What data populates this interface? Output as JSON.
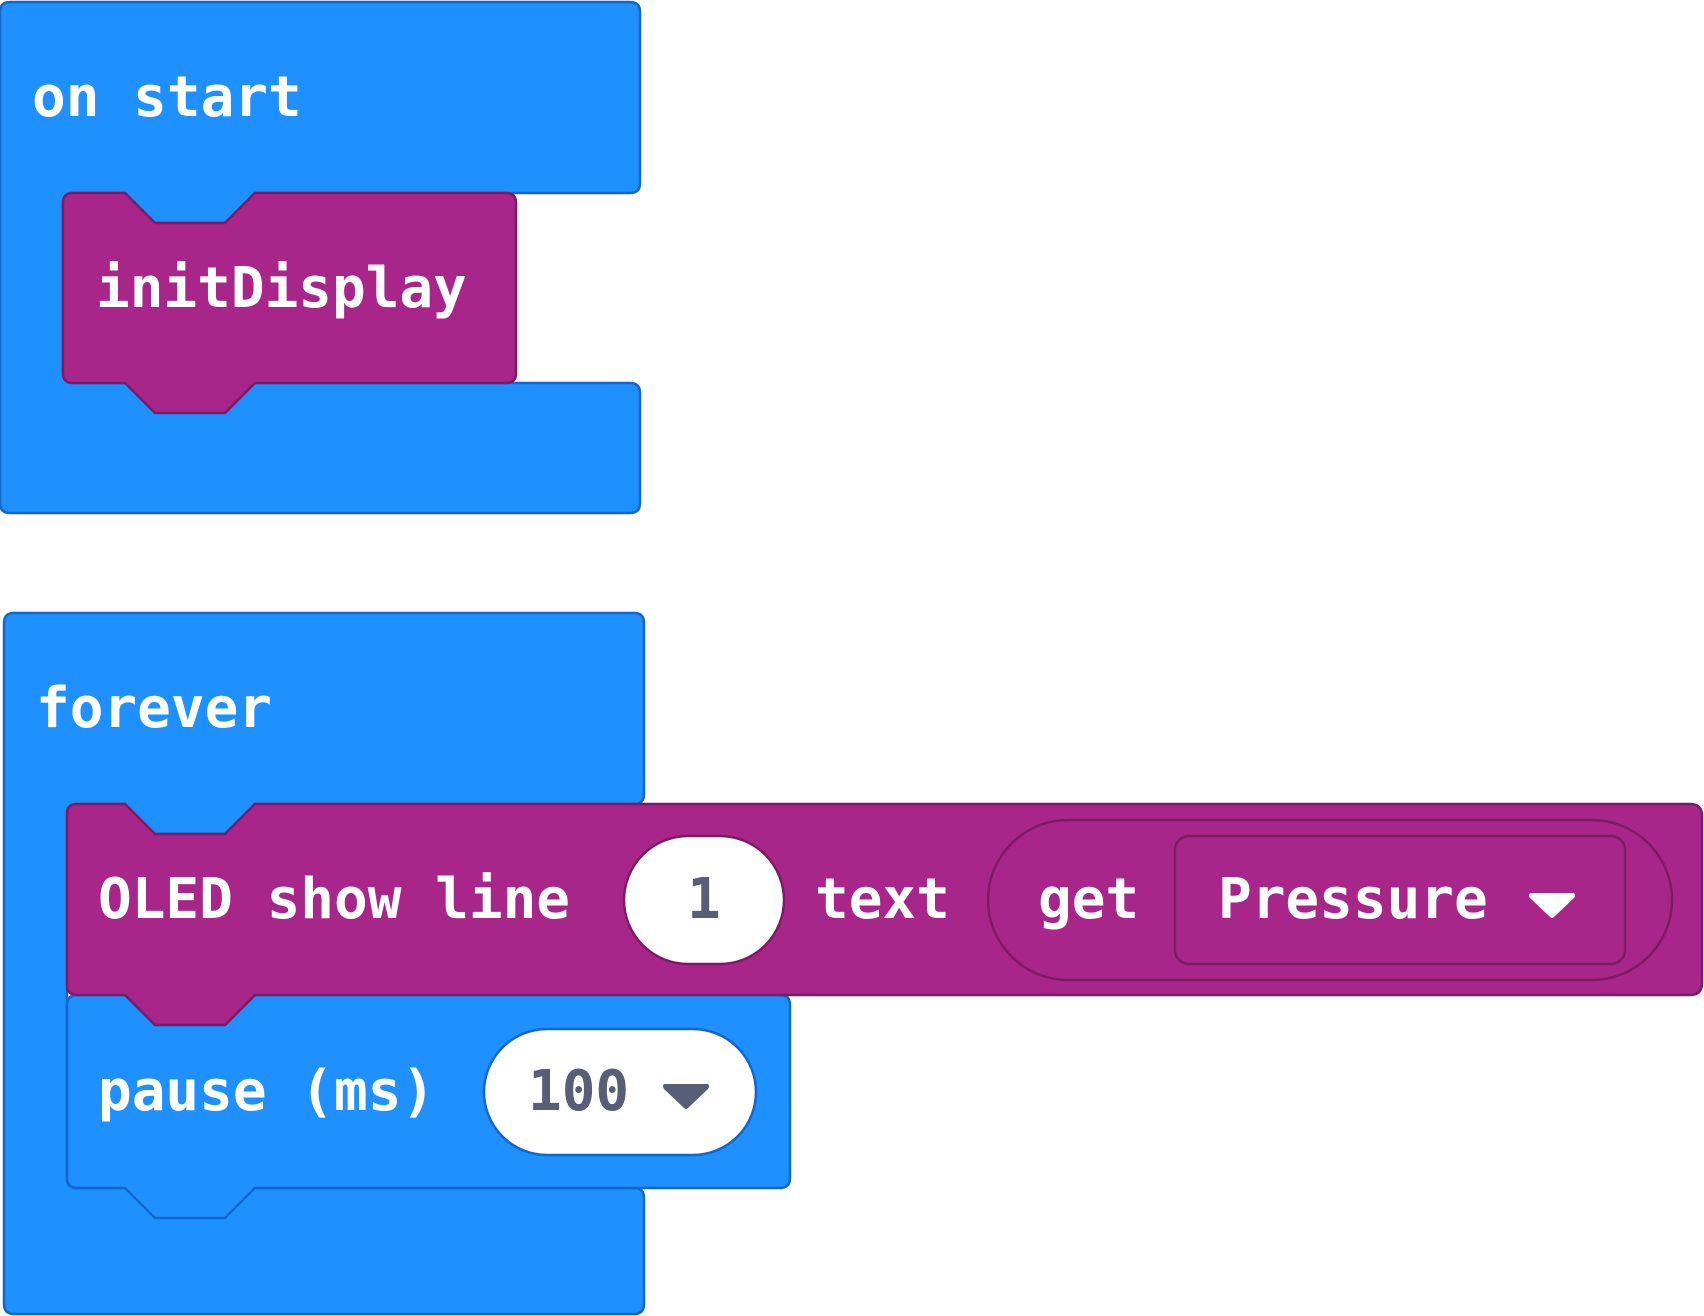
{
  "workspace": {
    "on_start": {
      "label": "on start",
      "child": {
        "label": "initDisplay"
      }
    },
    "forever": {
      "label": "forever",
      "oled": {
        "prefix": "OLED show line",
        "line_value": "1",
        "text_label": "text",
        "get_label": "get",
        "get_option": "Pressure",
        "dropdown_icon": "caret-down-icon"
      },
      "pause": {
        "label": "pause (ms)",
        "value": "100",
        "dropdown_icon": "caret-down-icon"
      }
    }
  },
  "colors": {
    "event_blue": "#1e90ff",
    "event_blue_border": "#1467c9",
    "purple": "#a8268a",
    "purple_border": "#7c1a66",
    "value_text": "#575e75"
  }
}
